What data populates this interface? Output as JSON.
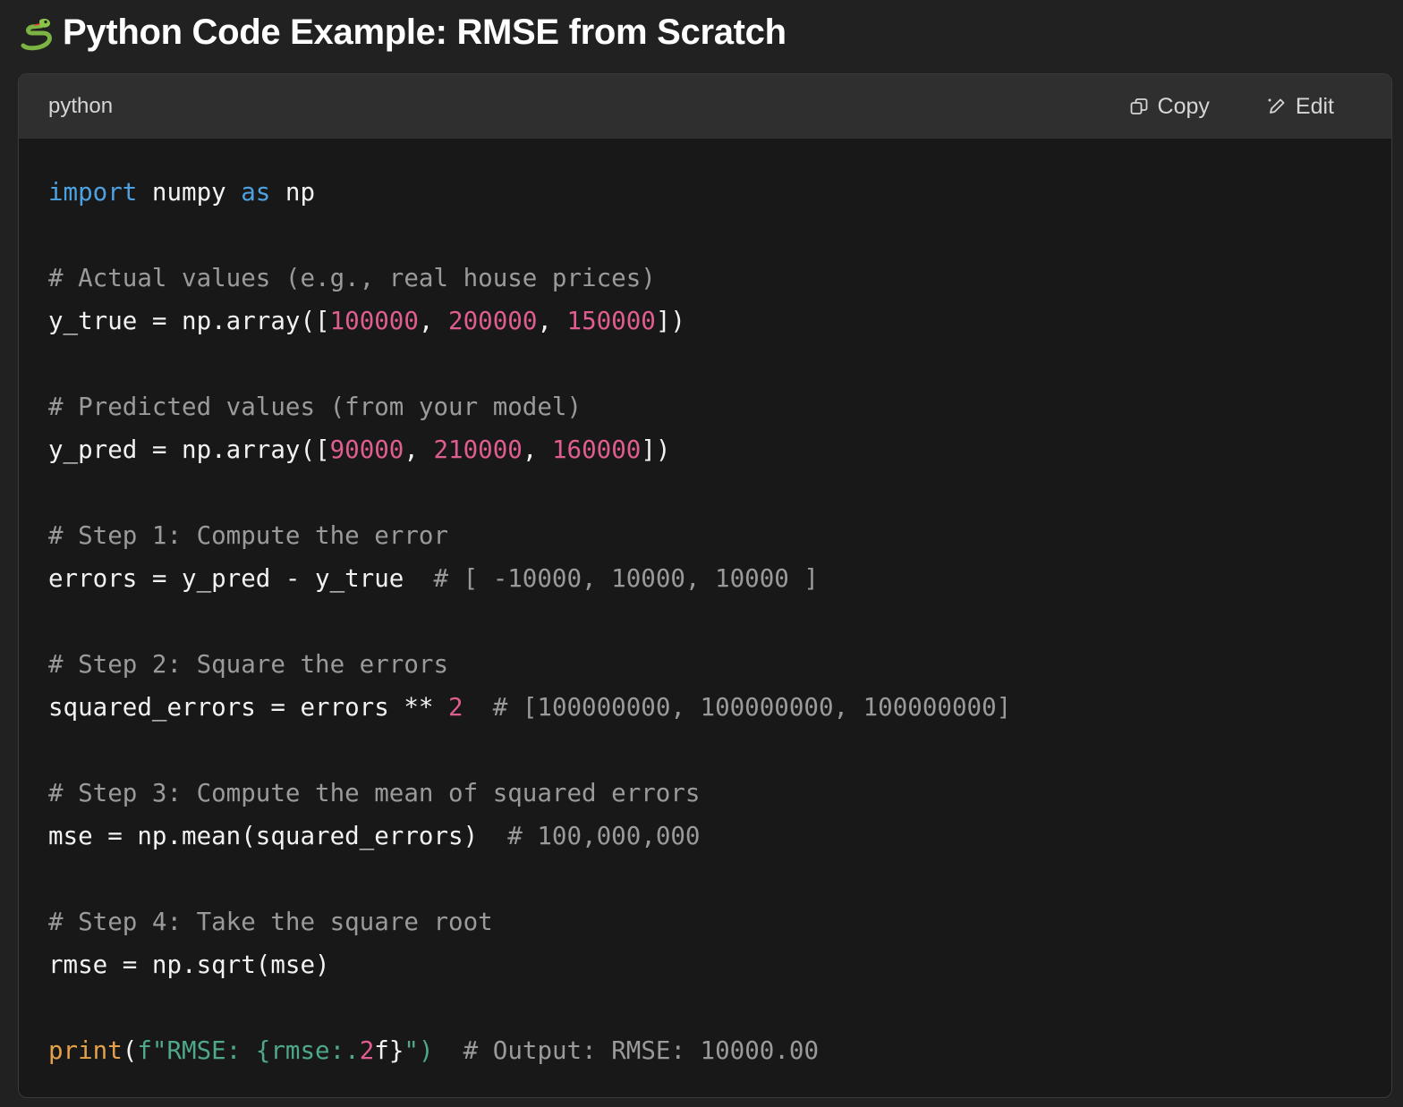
{
  "heading": {
    "icon": "snake-icon",
    "title": "Python Code Example: RMSE from Scratch"
  },
  "code_block": {
    "language": "python",
    "copy_label": "Copy",
    "edit_label": "Edit",
    "lines": {
      "l1": {
        "a": "import",
        "b": " numpy ",
        "c": "as",
        "d": " np"
      },
      "l3": {
        "a": "# Actual values (e.g., real house prices)"
      },
      "l4": {
        "a": "y_true = np.array([",
        "b": "100000",
        "c": ", ",
        "d": "200000",
        "e": ", ",
        "f": "150000",
        "g": "])"
      },
      "l6": {
        "a": "# Predicted values (from your model)"
      },
      "l7": {
        "a": "y_pred = np.array([",
        "b": "90000",
        "c": ", ",
        "d": "210000",
        "e": ", ",
        "f": "160000",
        "g": "])"
      },
      "l9": {
        "a": "# Step 1: Compute the error"
      },
      "l10": {
        "a": "errors = y_pred - y_true  ",
        "b": "# [ -10000, 10000, 10000 ]"
      },
      "l12": {
        "a": "# Step 2: Square the errors"
      },
      "l13": {
        "a": "squared_errors = errors ** ",
        "b": "2",
        "c": "  ",
        "d": "# [100000000, 100000000, 100000000]"
      },
      "l15": {
        "a": "# Step 3: Compute the mean of squared errors"
      },
      "l16": {
        "a": "mse = np.mean(squared_errors)  ",
        "b": "# 100,000,000"
      },
      "l18": {
        "a": "# Step 4: Take the square root"
      },
      "l19": {
        "a": "rmse = np.sqrt(mse)"
      },
      "l21": {
        "a": "print",
        "b": "(",
        "c": "f\"RMSE: {rmse:.",
        "d": "2",
        "e": "f}",
        "f": "\")",
        "g": "  ",
        "h": "# Output: RMSE: 10000.00"
      }
    }
  },
  "colors": {
    "keyword": "#4ea1e0",
    "number": "#e05d8f",
    "comment": "#9a9a9a",
    "builtin": "#e3a14a",
    "string": "#4ea889",
    "background": "#212121",
    "code_background": "#181818",
    "header_background": "#2f2f2f"
  }
}
